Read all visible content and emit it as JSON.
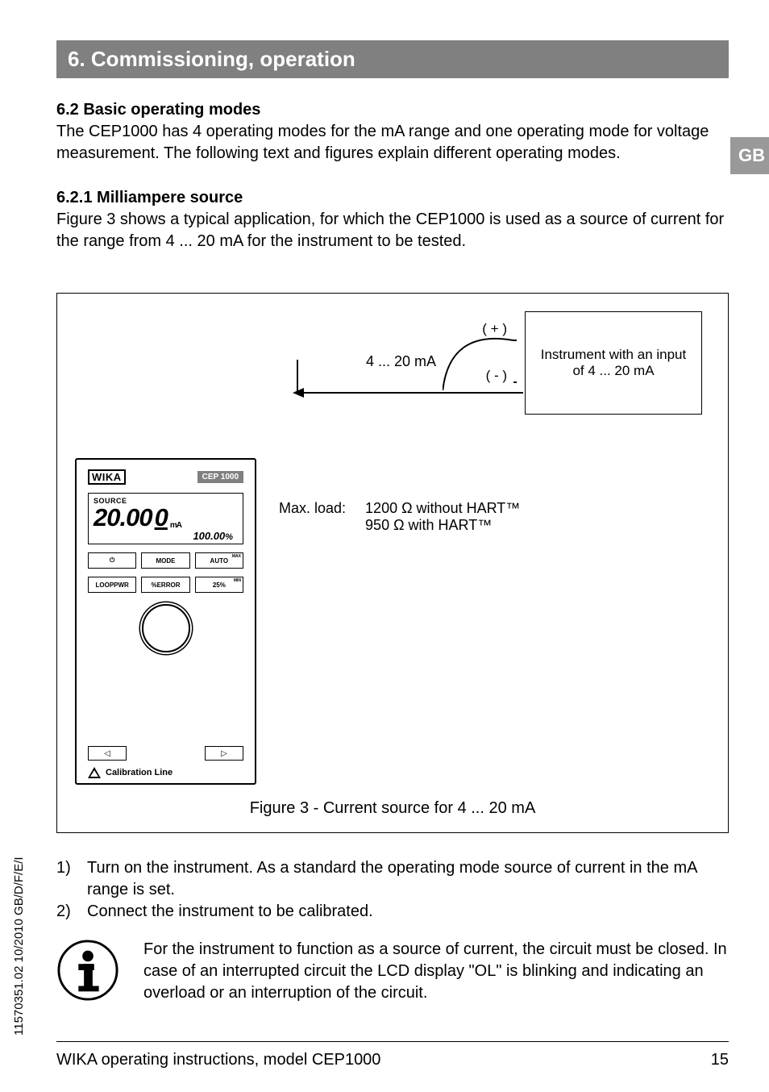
{
  "header": {
    "title": "6. Commissioning, operation"
  },
  "lang_tab": "GB",
  "section62": {
    "title": "6.2 Basic operating modes",
    "text": "The CEP1000 has 4 operating modes for the mA range and one operating mode for voltage measurement. The following text and figures explain different operating modes."
  },
  "section621": {
    "title": "6.2.1 Milliampere source",
    "text": "Figure 3 shows a typical application, for which the CEP1000 is used as a source of current for the range from 4 ... 20 mA for the instrument to be tested."
  },
  "figure": {
    "plus": "( + )",
    "minus": "( - )",
    "ma_label": "4 ... 20 mA",
    "inst_box_l1": "Instrument with an input",
    "inst_box_l2": "of 4 ... 20 mA",
    "max_load_label": "Max. load:",
    "max_load_l1": "1200 Ω without HART™",
    "max_load_l2": "950 Ω with HART™",
    "caption": "Figure 3 -  Current source for 4 ... 20 mA"
  },
  "device": {
    "brand": "WIKA",
    "model": "CEP 1000",
    "src": "SOURCE",
    "reading_main": "20.00",
    "reading_last": "0",
    "reading_unit": "mA",
    "pct": "100.00",
    "pct_sym": "%",
    "buttons_row1": {
      "b1": "⏻",
      "b2": "MODE",
      "b3": "AUTO",
      "b3sup": "MAX"
    },
    "buttons_row2": {
      "b1": "LOOPPWR",
      "b2": "%ERROR",
      "b3": "25%",
      "b3sup": "MIN"
    },
    "nav_left": "◁",
    "nav_right": "▷",
    "cal": "Calibration Line"
  },
  "steps": {
    "num1": "1)",
    "s1": "Turn on the instrument. As a standard the operating mode source of current in the mA range is set.",
    "num2": "2)",
    "s2": "Connect the instrument to be calibrated."
  },
  "note": {
    "text": "For the instrument to function as a source of current, the circuit must be closed. In case of an interrupted circuit the LCD display \"OL\" is blinking and indicating an overload or an interruption of the circuit."
  },
  "side_code": "11570351.02 10/2010 GB/D/F/E/I",
  "footer": {
    "left": "WIKA operating instructions, model CEP1000",
    "right": "15"
  }
}
